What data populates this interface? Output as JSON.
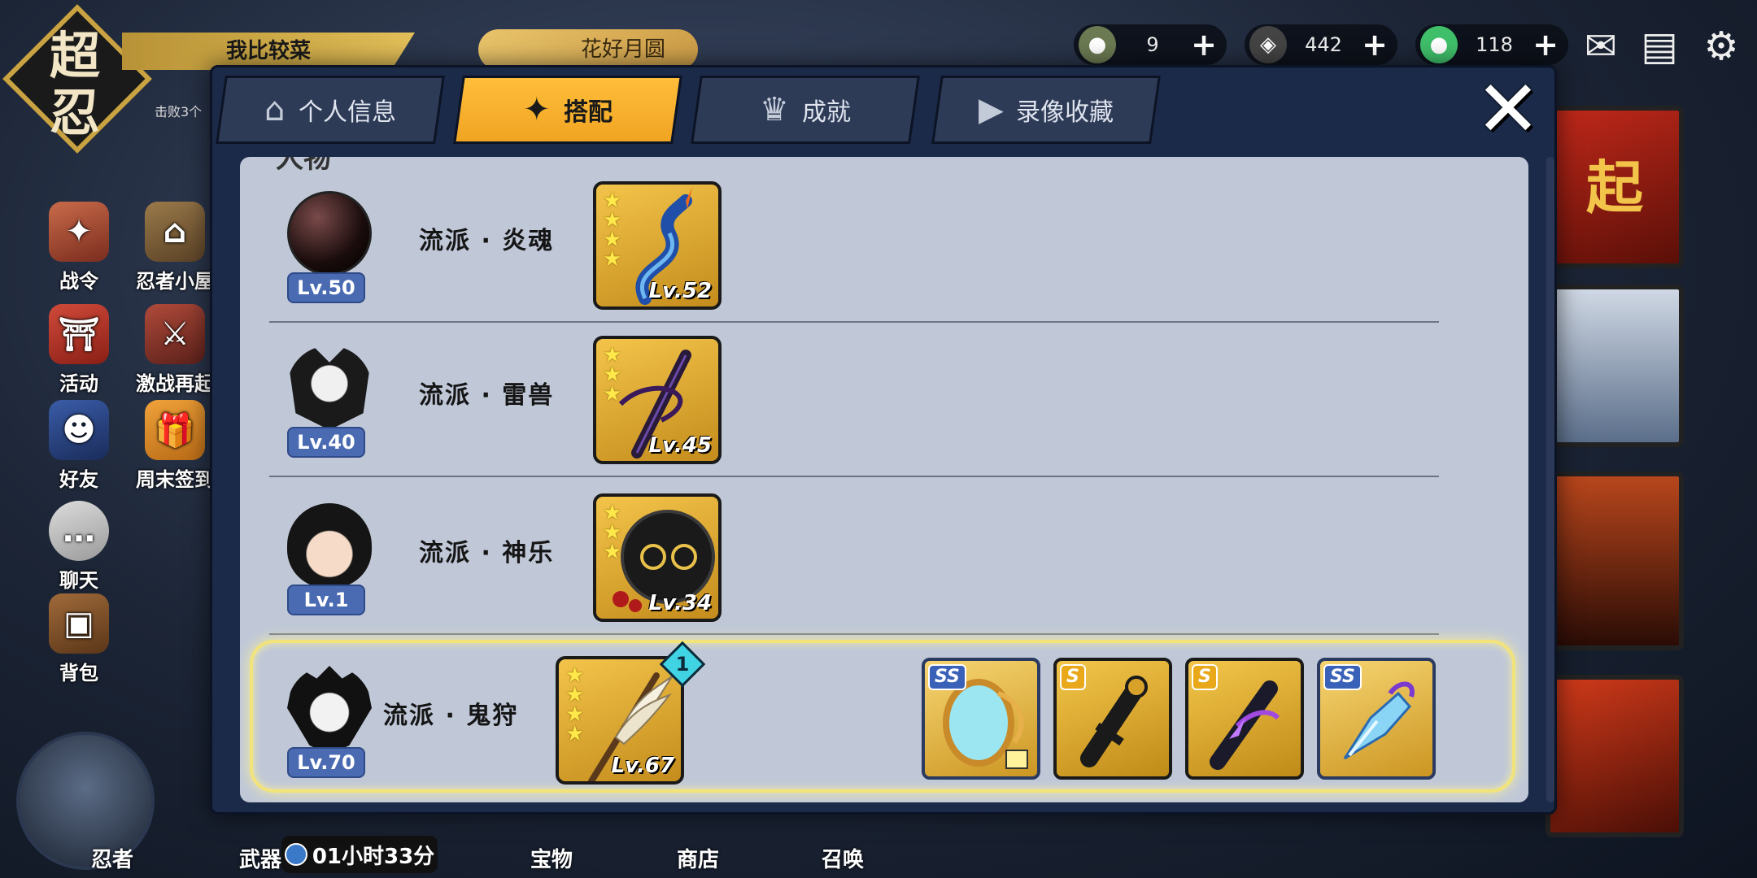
{
  "hud": {
    "logo_text": "超忍",
    "rank_title": "我比较菜",
    "rank_sub": "击败3个",
    "event_label": "花好月圆",
    "currencies": [
      {
        "name": "rice-ball",
        "value": "9",
        "color": "#6b7a52"
      },
      {
        "name": "coin",
        "value": "442",
        "color": "#444444"
      },
      {
        "name": "jade",
        "value": "118",
        "color": "#3fbf6a"
      }
    ],
    "plus": "+",
    "side_menu": [
      {
        "label": "战令",
        "icon": "battle-pass-icon"
      },
      {
        "label": "忍者小屋",
        "icon": "ninja-house-icon"
      },
      {
        "label": "活动",
        "icon": "torii-icon"
      },
      {
        "label": "激战再起",
        "icon": "crossed-swords-icon"
      },
      {
        "label": "好友",
        "icon": "ninja-friend-icon"
      },
      {
        "label": "周末签到",
        "icon": "gift-box-icon"
      },
      {
        "label": "聊天",
        "icon": "chat-bubble-icon"
      },
      {
        "label": "背包",
        "icon": "backpack-icon"
      }
    ],
    "bottom_nav": [
      "忍者",
      "武器",
      "宝物",
      "商店",
      "召唤"
    ],
    "timer": "01小时33分",
    "right_banner_text": "起"
  },
  "tabs": [
    {
      "label": "个人信息",
      "icon": "profile-icon",
      "active": false
    },
    {
      "label": "搭配",
      "icon": "shuriken-icon",
      "active": true
    },
    {
      "label": "成就",
      "icon": "trophy-icon",
      "active": false
    },
    {
      "label": "录像收藏",
      "icon": "play-icon",
      "active": false
    }
  ],
  "close_label": "✕",
  "section_header": "人物",
  "rows": [
    {
      "style": "流派 · 炎魂",
      "level": "Lv.50",
      "weapon_level": "Lv.52",
      "weapon_stars": 4,
      "avatar": "dark-orb-avatar",
      "selected": false,
      "items": []
    },
    {
      "style": "流派 · 雷兽",
      "level": "Lv.40",
      "weapon_level": "Lv.45",
      "weapon_stars": 3,
      "avatar": "masked-ninja-avatar",
      "selected": false,
      "items": []
    },
    {
      "style": "流派 · 神乐",
      "level": "Lv.1",
      "weapon_level": "Lv.34",
      "weapon_stars": 3,
      "avatar": "girl-ninja-avatar",
      "selected": false,
      "items": []
    },
    {
      "style": "流派 · 鬼狩",
      "level": "Lv.70",
      "weapon_level": "Lv.67",
      "weapon_stars": 4,
      "avatar": "fox-mask-avatar",
      "selected": true,
      "rank_badge": "1",
      "items": [
        {
          "grade": "SS",
          "name": "mirror-icon"
        },
        {
          "grade": "S",
          "name": "scroll-icon"
        },
        {
          "grade": "S",
          "name": "purple-scroll-icon"
        },
        {
          "grade": "SS",
          "name": "crystal-icon"
        }
      ]
    }
  ]
}
